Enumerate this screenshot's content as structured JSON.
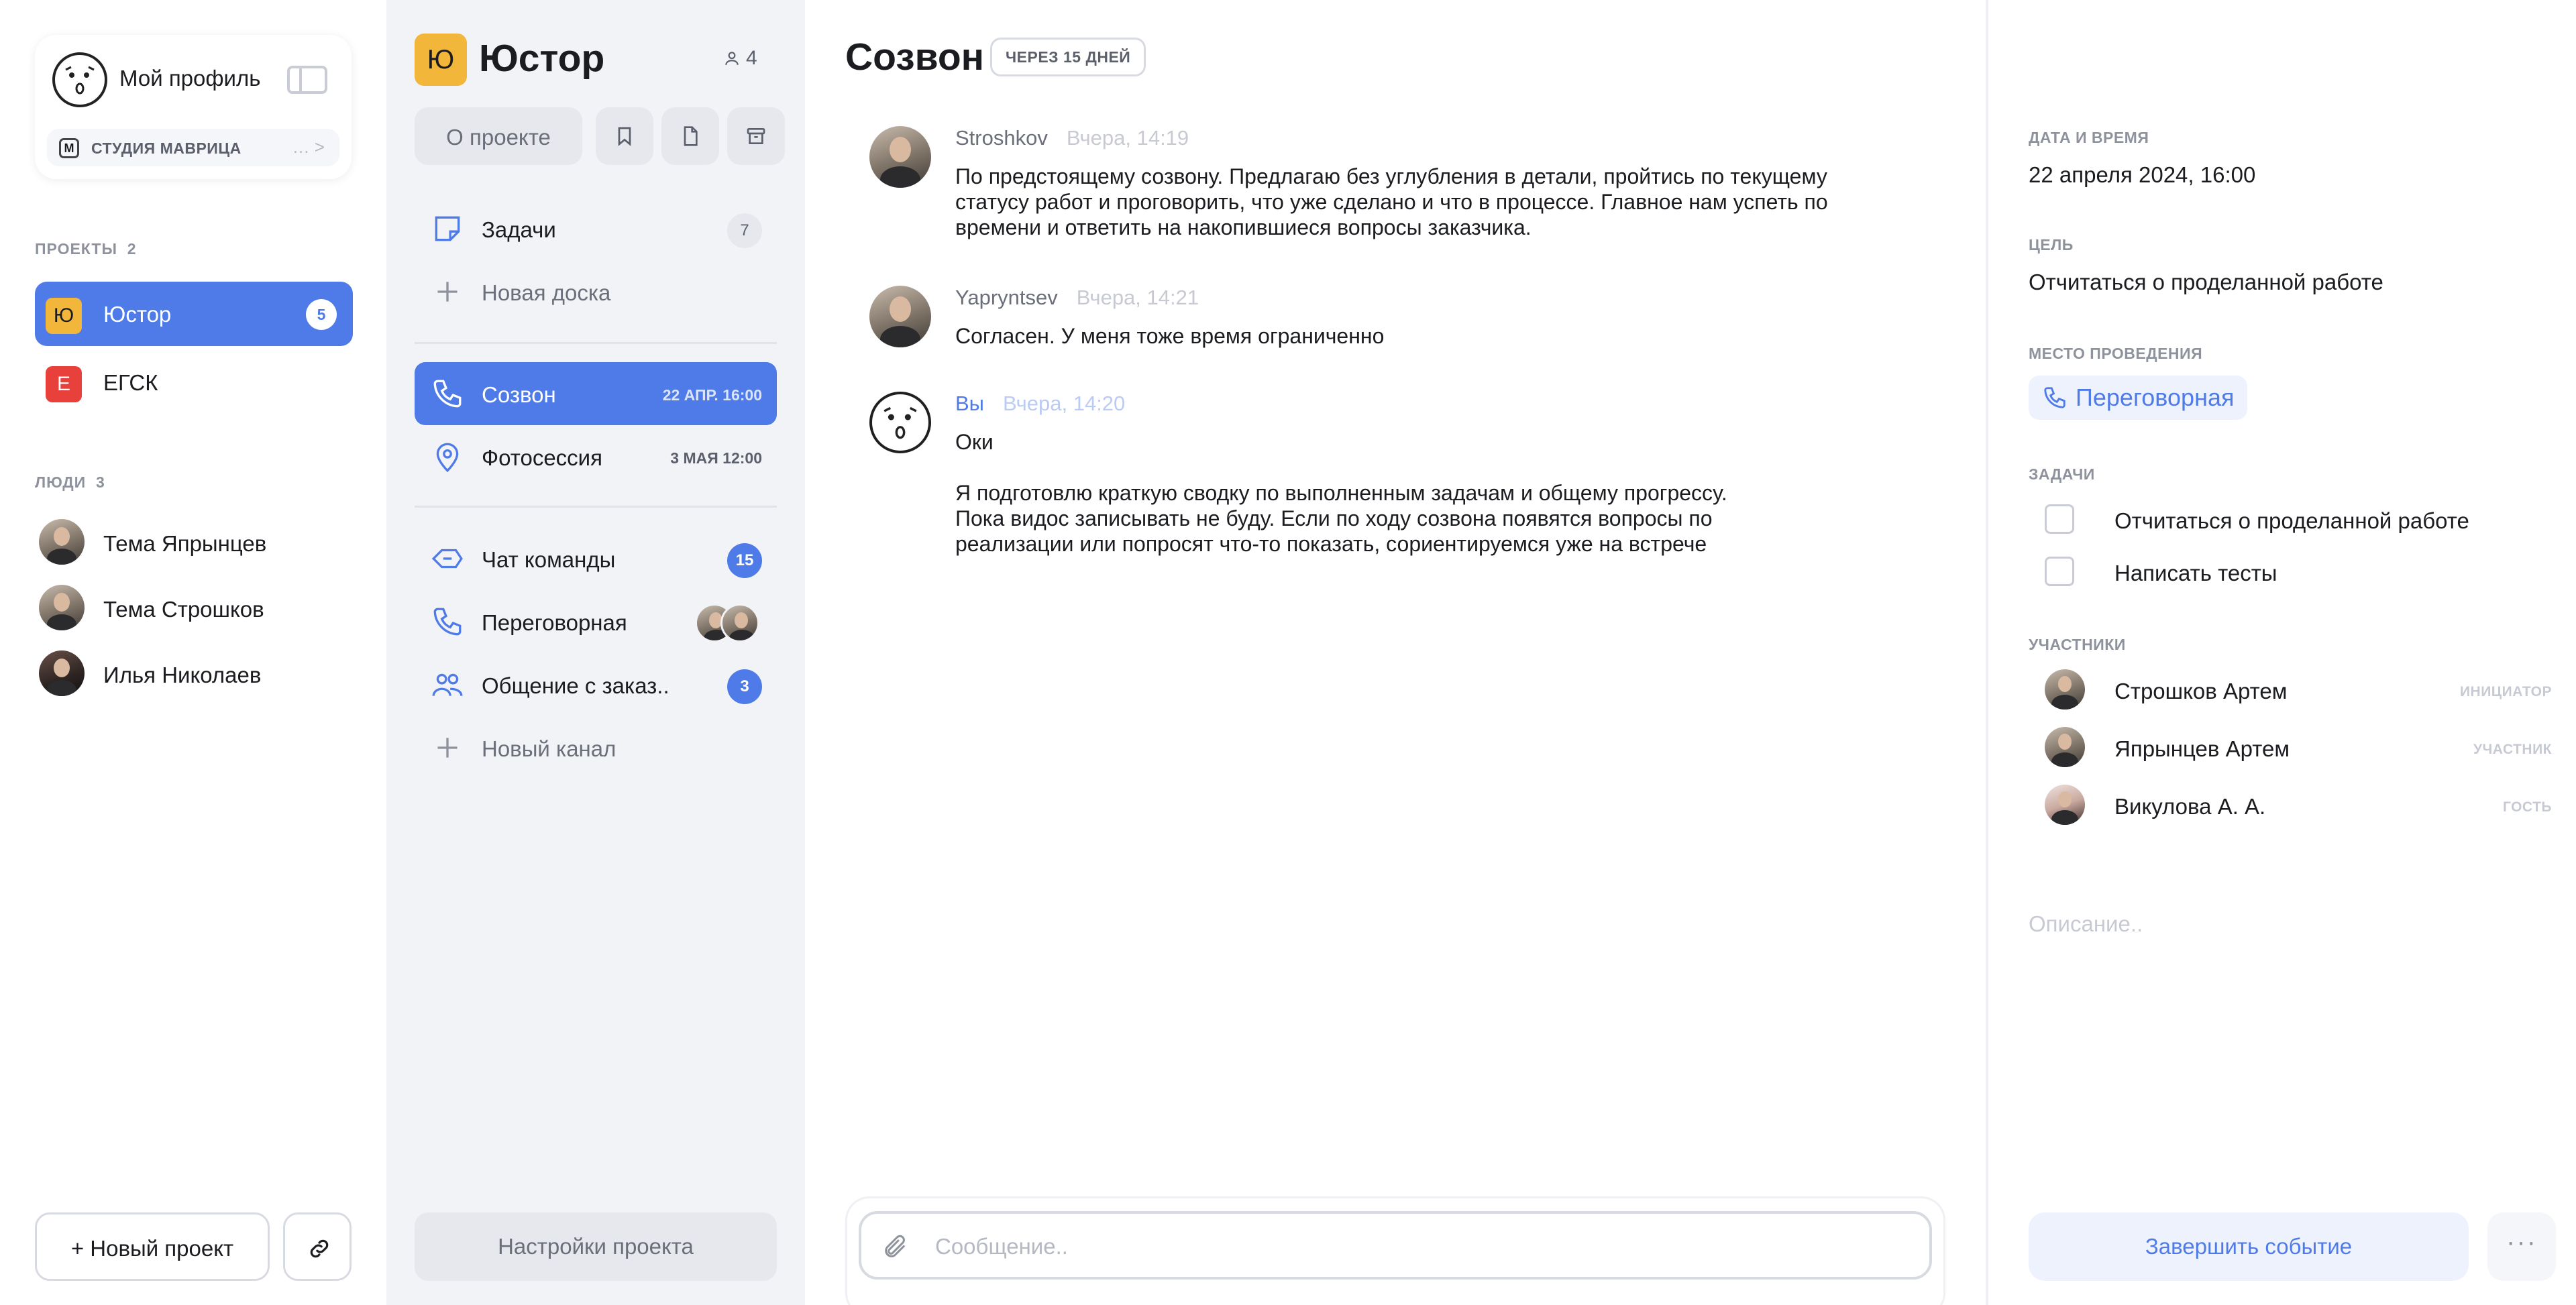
{
  "profile": {
    "name": "Мой профиль",
    "studio_badge": "M",
    "studio_name": "СТУДИЯ МАВРИЦА",
    "studio_more": "… >"
  },
  "projects": {
    "label": "ПРОЕКТЫ",
    "count": "2",
    "items": [
      {
        "letter": "Ю",
        "name": "Юстор",
        "badge": "5",
        "color": "#f2b73a",
        "active": true
      },
      {
        "letter": "Е",
        "name": "ЕГСК",
        "color": "#e8413c",
        "active": false
      }
    ]
  },
  "people": {
    "label": "ЛЮДИ",
    "count": "3",
    "items": [
      {
        "name": "Тема Япрынцев"
      },
      {
        "name": "Тема Строшков"
      },
      {
        "name": "Илья Николаев"
      }
    ]
  },
  "sidebar_footer": {
    "new_project": "+ Новый проект"
  },
  "workspace": {
    "logo_letter": "Ю",
    "title": "Юстор",
    "members": "4",
    "about": "О проекте",
    "channels_top": [
      {
        "name": "Задачи",
        "badge": "7",
        "icon": "sticky-note-icon"
      },
      {
        "name": "Новая доска",
        "icon": "plus-icon"
      }
    ],
    "events": [
      {
        "name": "Созвон",
        "date": "22 АПР. 16:00",
        "icon": "phone-icon",
        "active": true
      },
      {
        "name": "Фотосессия",
        "date": "3 МАЯ 12:00",
        "icon": "location-pin-icon"
      }
    ],
    "chats": [
      {
        "name": "Чат команды",
        "badge": "15",
        "icon": "chat-tag-icon"
      },
      {
        "name": "Переговорная",
        "icon": "phone-icon"
      },
      {
        "name": "Общение с заказ..",
        "badge": "3",
        "icon": "people-icon"
      },
      {
        "name": "Новый канал",
        "icon": "plus-icon"
      }
    ],
    "settings": "Настройки проекта"
  },
  "event": {
    "title": "Созвон",
    "due": "ЧЕРЕЗ 15 ДНЕЙ",
    "messages": [
      {
        "author": "Stroshkov",
        "time": "Вчера, 14:19",
        "text": "По предстоящему созвону. Предлагаю без углубления в детали, пройтись по текущему\nстатусу работ и проговорить, что уже сделано и что в процессе. Главное нам успеть по\nвремени и ответить на накопившиеся вопросы заказчика."
      },
      {
        "author": "Yapryntsev",
        "time": "Вчера, 14:21",
        "text": "Согласен. У меня тоже время ограниченно"
      },
      {
        "author": "Вы",
        "time": "Вчера, 14:20",
        "text": "Оки\n\nЯ подготовлю краткую сводку по выполненным задачам и общему прогрессу.\nПока видос записывать не буду. Если по ходу созвона появятся вопросы по\nреализации или попросят что-то показать, сориентируемся уже на встрече"
      }
    ],
    "composer_placeholder": "Сообщение.."
  },
  "details": {
    "datetime_label": "ДАТА И ВРЕМЯ",
    "datetime": "22 апреля 2024, 16:00",
    "goal_label": "ЦЕЛЬ",
    "goal": "Отчитаться о проделанной работе",
    "place_label": "МЕСТО ПРОВЕДЕНИЯ",
    "place": "Переговорная",
    "tasks_label": "ЗАДАЧИ",
    "tasks": [
      {
        "text": "Отчитаться о проделанной работе"
      },
      {
        "text": "Написать тесты"
      }
    ],
    "participants_label": "УЧАСТНИКИ",
    "participants": [
      {
        "name": "Строшков Артем",
        "role": "ИНИЦИАТОР"
      },
      {
        "name": "Япрынцев Артем",
        "role": "УЧАСТНИК"
      },
      {
        "name": "Викулова А. А.",
        "role": "ГОСТЬ"
      }
    ],
    "description_placeholder": "Описание..",
    "finish": "Завершить событие",
    "more": "···"
  },
  "colors": {
    "accent": "#4f7be8",
    "accent_soft": "#edf2fd",
    "panel_bg": "#f2f3f7"
  }
}
